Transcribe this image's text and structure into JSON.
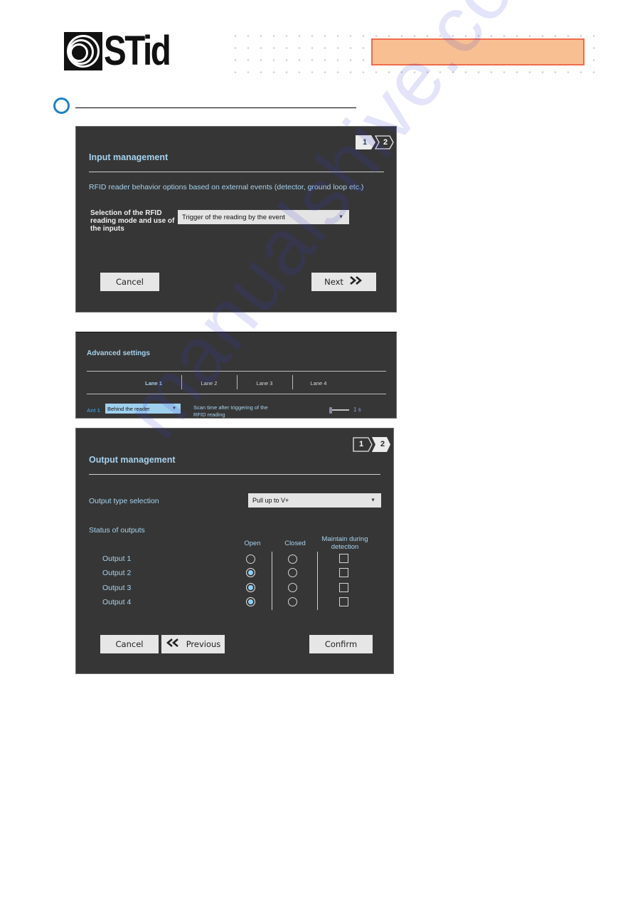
{
  "header": {
    "brand": "STid",
    "logo_icon": "stid-concentric-circles-logo",
    "accent_colors": {
      "orange_fill": "#f8c092",
      "orange_border": "#ef6b4d",
      "bullet_blue": "#1b82c5"
    }
  },
  "input_panel": {
    "steps": [
      "1",
      "2"
    ],
    "active_step": 1,
    "title": "Input management",
    "description": "RFID reader behavior options based on external events (detector, ground loop etc.)",
    "mode_label": "Selection of the RFID reading mode and use of the inputs",
    "mode_label_lines": [
      "Selection of the RFID",
      "reading mode and use of",
      "the inputs"
    ],
    "mode_select": {
      "value": "Trigger of the reading by the event",
      "caret": "▼"
    },
    "cancel_label": "Cancel",
    "next_label": "Next",
    "next_icon": "»"
  },
  "advanced_panel": {
    "title": "Advanced settings",
    "lanes": [
      "Lane 1",
      "Lane 2",
      "Lane 3",
      "Lane 4"
    ],
    "active_lane": "Lane 1",
    "antenna_label": "Ant 1",
    "antenna_select": {
      "value": "Behind the reader",
      "caret": "▼"
    },
    "scan_time_label_lines": [
      "Scan time after triggering of the",
      "RFID reading"
    ],
    "scan_time_value": "1 s",
    "scan_time_slider_fraction": 0.0
  },
  "output_panel": {
    "steps": [
      "1",
      "2"
    ],
    "active_step": 2,
    "title": "Output management",
    "output_type_label": "Output type selection",
    "output_type_select": {
      "value": "Pull up to V+",
      "caret": "▼"
    },
    "status_label": "Status of outputs",
    "columns": {
      "open": "Open",
      "closed": "Closed",
      "maintain_lines": [
        "Maintain during",
        "detection"
      ]
    },
    "outputs": [
      {
        "label": "Output 1",
        "open": false,
        "closed": false,
        "maintain": false
      },
      {
        "label": "Output 2",
        "open": true,
        "closed": false,
        "maintain": false
      },
      {
        "label": "Output 3",
        "open": true,
        "closed": false,
        "maintain": false
      },
      {
        "label": "Output 4",
        "open": true,
        "closed": false,
        "maintain": false
      }
    ],
    "cancel_label": "Cancel",
    "previous_label": "Previous",
    "previous_icon": "«",
    "confirm_label": "Confirm"
  },
  "watermark": "manualshive.com"
}
